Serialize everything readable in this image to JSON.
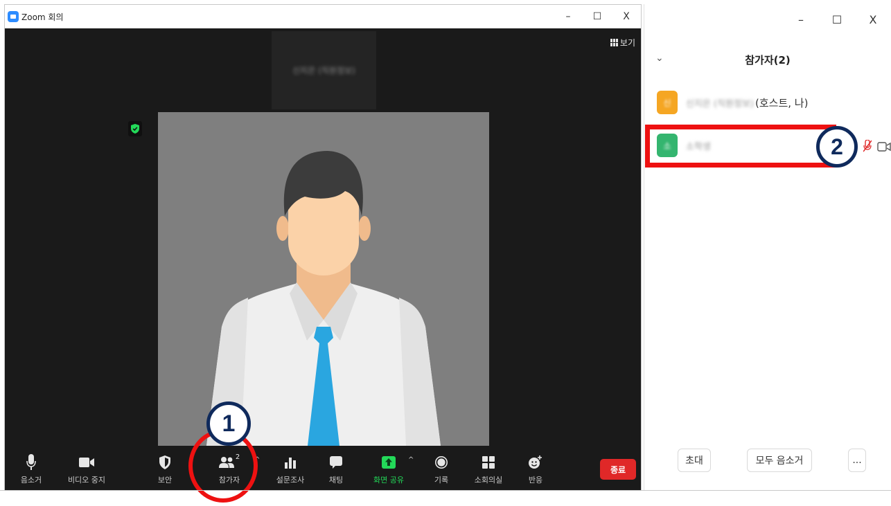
{
  "window": {
    "title": "Zoom 회의",
    "controls": {
      "minimize": "–",
      "maximize": "☐",
      "close": "X"
    }
  },
  "stage": {
    "self_name_blurred": "신지은 (직원정보)",
    "view_label": "보기"
  },
  "toolbar": {
    "items": [
      {
        "label": "음소거",
        "icon": "microphone-icon"
      },
      {
        "label": "비디오 중지",
        "icon": "video-camera-icon"
      },
      {
        "label": "보안",
        "icon": "shield-icon"
      },
      {
        "label": "참가자",
        "icon": "participants-icon",
        "count": "2"
      },
      {
        "label": "설문조사",
        "icon": "poll-icon"
      },
      {
        "label": "채팅",
        "icon": "chat-icon"
      },
      {
        "label": "화면 공유",
        "icon": "share-screen-icon"
      },
      {
        "label": "기록",
        "icon": "record-icon"
      },
      {
        "label": "소회의실",
        "icon": "breakout-rooms-icon"
      },
      {
        "label": "반응",
        "icon": "reactions-icon"
      }
    ],
    "end_label": "종료",
    "colors": {
      "share": "#23d959",
      "end": "#e02828"
    }
  },
  "panel": {
    "title": "참가자(2)",
    "participants": [
      {
        "name_blurred": "신지은 (직원정보)",
        "role": "(호스트, 나)",
        "avatar_color": "#f5a623",
        "avatar_letter": "신"
      },
      {
        "name_blurred": "소학생",
        "role": "",
        "avatar_color": "#34b56f",
        "avatar_letter": "소"
      }
    ],
    "footer": {
      "invite": "초대",
      "mute_all": "모두 음소거",
      "more": "..."
    }
  },
  "annotations": {
    "badge_1": "1",
    "badge_2": "2"
  }
}
